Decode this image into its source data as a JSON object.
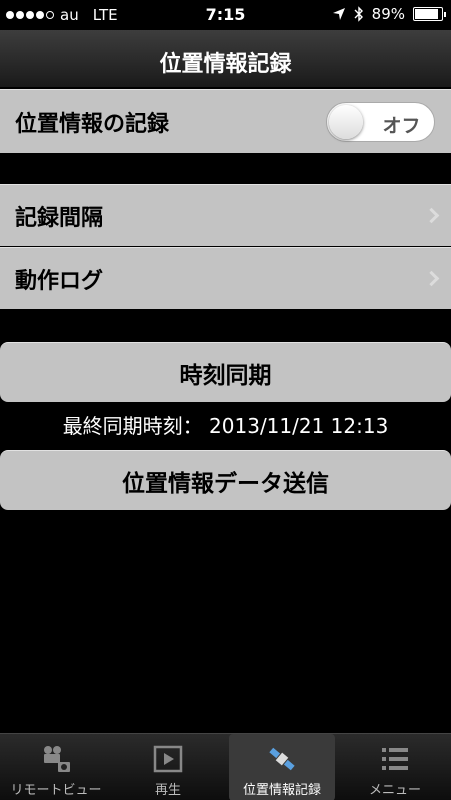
{
  "status_bar": {
    "carrier": "au",
    "network": "LTE",
    "time": "7:15",
    "battery_percent": "89%",
    "battery_level": 0.89,
    "signal_bars": 4
  },
  "nav": {
    "title": "位置情報記録"
  },
  "settings": {
    "recording_label": "位置情報の記録",
    "toggle_state": "オフ",
    "interval_label": "記録間隔",
    "log_label": "動作ログ"
  },
  "sync": {
    "button_label": "時刻同期",
    "last_sync": "最終同期時刻： 2013/11/21 12:13"
  },
  "send": {
    "button_label": "位置情報データ送信"
  },
  "tabs": [
    {
      "label": "リモートビュー",
      "icon": "camera-icon"
    },
    {
      "label": "再生",
      "icon": "play-icon"
    },
    {
      "label": "位置情報記録",
      "icon": "satellite-icon",
      "active": true
    },
    {
      "label": "メニュー",
      "icon": "menu-icon"
    }
  ],
  "colors": {
    "cell_bg": "#c3c3c3",
    "background": "#000000"
  }
}
